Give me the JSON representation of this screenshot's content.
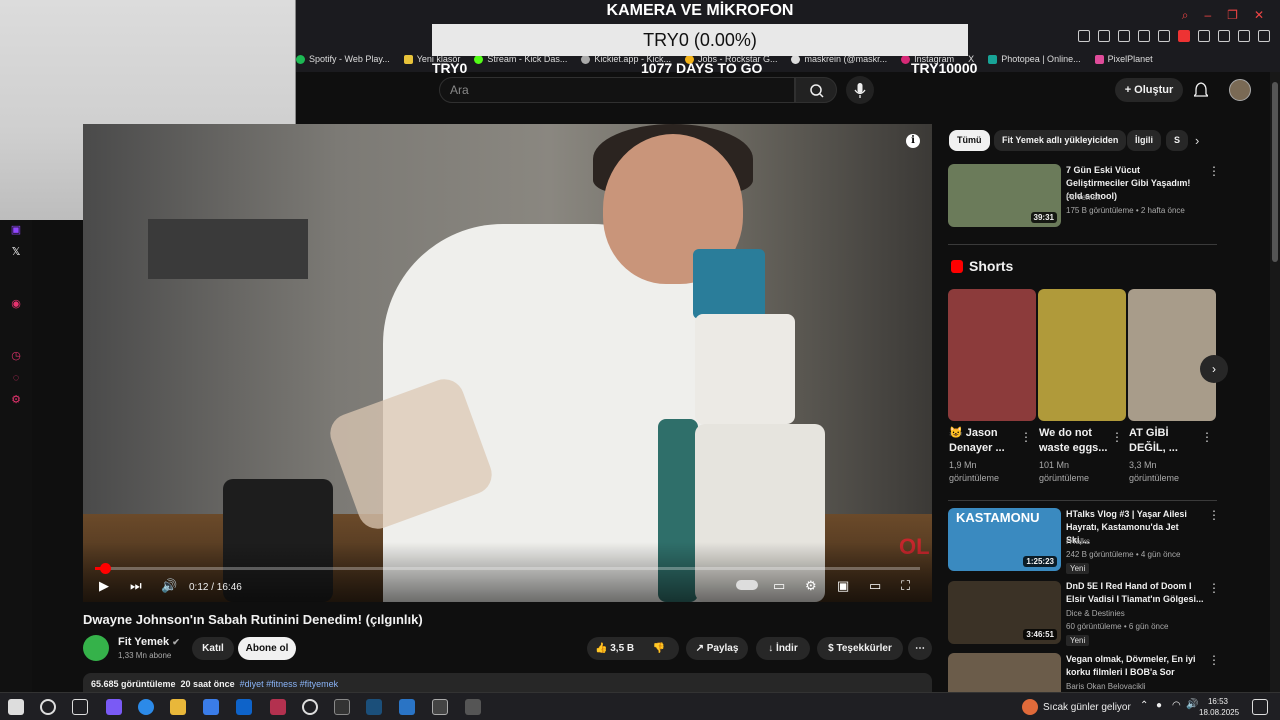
{
  "browser": {
    "bookmarks": [
      "Spotify - Web Play...",
      "Yeni klasör",
      "Stream - Kick Das...",
      "Kickiet.app - Kick...",
      "Jobs - Rockstar G...",
      "maskrein (@maskr...",
      "Instagram",
      "X",
      "Photopea | Online...",
      "PixelPlanet"
    ]
  },
  "overlay": {
    "title": "KAMERA VE MİKROFON",
    "bar_text": "TRY0 (0.00%)",
    "left_label": "TRY0",
    "center_label": "1077 DAYS TO GO",
    "right_label": "TRY10000",
    "progress_fraction": 0.0
  },
  "header": {
    "search_placeholder": "Ara",
    "create_label": "Oluştur"
  },
  "player": {
    "time": "0:12 / 16:46",
    "progress_fraction": 0.012,
    "info_label": "i",
    "logo_text": "OL"
  },
  "video": {
    "title": "Dwayne Johnson'ın Sabah Rutinini Denedim! (çılgınlık)",
    "channel": "Fit Yemek",
    "subscribers": "1,33 Mn abone",
    "join_label": "Katıl",
    "subscribe_label": "Abone ol",
    "likes": "3,5 B",
    "share_label": "Paylaş",
    "download_label": "İndir",
    "thanks_label": "Teşekkürler",
    "views": "65.685 görüntüleme",
    "age": "20 saat önce",
    "tags": "#diyet #fitness #fityemek"
  },
  "chips": [
    "Tümü",
    "Fit Yemek adlı yükleyiciden",
    "İlgili",
    "S"
  ],
  "recommended": [
    {
      "title": "7 Gün Eski Vücut Geliştirmeciler Gibi Yaşadım! (old school)",
      "channel": "Fit Yemek",
      "meta": "175 B görüntüleme • 2 hafta önce",
      "duration": "39:31",
      "badge": "",
      "color": "#6b7b5a"
    },
    {
      "title": "HTalks Vlog #3 | Yaşar Ailesi Hayratı, Kastamonu'da Jet Ski,...",
      "channel": "HTalks",
      "meta": "242 B görüntüleme • 4 gün önce",
      "duration": "1:25:23",
      "badge": "Yeni",
      "color": "#3a8ac0",
      "thumb_text": "KASTAMONU"
    },
    {
      "title": "DnD 5E I Red Hand of Doom I Elsir Vadisi I Tiamat'ın Gölgesi...",
      "channel": "Dice & Destinies",
      "meta": "60 görüntüleme • 6 gün önce",
      "duration": "3:46:51",
      "badge": "Yeni",
      "color": "#3b3226"
    },
    {
      "title": "Vegan olmak, Dövmeler, En iyi korku filmleri I BOB'a Sor",
      "channel": "Baris Okan Belovacikli",
      "meta": "",
      "duration": "",
      "badge": "",
      "color": "#6b5c4a"
    }
  ],
  "shorts": {
    "heading": "Shorts",
    "items": [
      {
        "title": "😺 Jason Denayer ...",
        "views": "1,9 Mn görüntüleme",
        "color": "#8c3b3b"
      },
      {
        "title": "We do not waste eggs...",
        "views": "101 Mn görüntüleme",
        "color": "#b09a3a"
      },
      {
        "title": "AT GİBİ DEĞİL, ...",
        "views": "3,3 Mn görüntüleme",
        "color": "#a89c8a"
      }
    ]
  },
  "taskbar": {
    "weather": "Sıcak günler geliyor",
    "time": "16:53",
    "date": "18.08.2025"
  },
  "colors": {
    "accent": "#ff0000",
    "twitch": "#9146ff",
    "background": "#0f0f0f"
  }
}
